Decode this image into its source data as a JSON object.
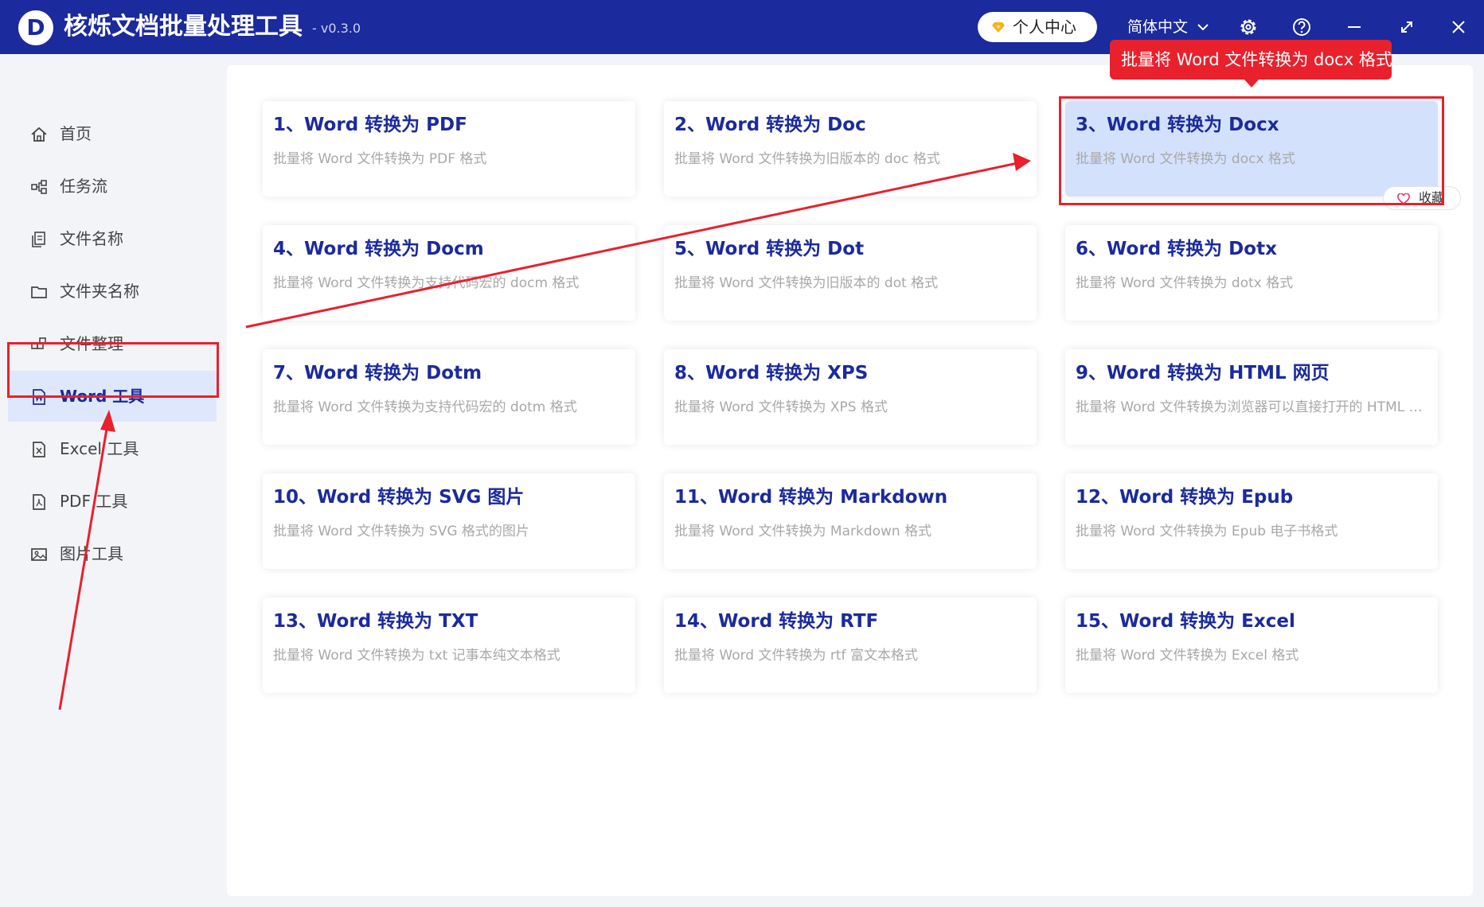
{
  "app": {
    "logo_letter": "D",
    "title": "核烁文档批量处理工具",
    "version": "- v0.3.0"
  },
  "header": {
    "profile_label": "个人中心",
    "language_label": "简体中文",
    "icons": [
      "diamond-icon",
      "chevron-down-icon",
      "gear-icon",
      "help-icon",
      "minimize-icon",
      "maximize-icon",
      "close-icon"
    ]
  },
  "sidebar": {
    "items": [
      {
        "label": "首页",
        "icon": "home-icon"
      },
      {
        "label": "任务流",
        "icon": "workflow-icon"
      },
      {
        "label": "文件名称",
        "icon": "file-name-icon"
      },
      {
        "label": "文件夹名称",
        "icon": "folder-icon"
      },
      {
        "label": "文件整理",
        "icon": "organize-icon"
      },
      {
        "label": "Word 工具",
        "icon": "word-file-icon",
        "active": true
      },
      {
        "label": "Excel 工具",
        "icon": "excel-file-icon"
      },
      {
        "label": "PDF 工具",
        "icon": "pdf-file-icon"
      },
      {
        "label": "图片工具",
        "icon": "image-icon"
      }
    ]
  },
  "tools": [
    {
      "title": "1、Word 转换为 PDF",
      "desc": "批量将 Word 文件转换为 PDF 格式"
    },
    {
      "title": "2、Word 转换为 Doc",
      "desc": "批量将 Word 文件转换为旧版本的 doc 格式"
    },
    {
      "title": "3、Word 转换为 Docx",
      "desc": "批量将 Word 文件转换为 docx 格式",
      "selected": true
    },
    {
      "title": "4、Word 转换为 Docm",
      "desc": "批量将 Word 文件转换为支持代码宏的 docm 格式"
    },
    {
      "title": "5、Word 转换为 Dot",
      "desc": "批量将 Word 文件转换为旧版本的 dot 格式"
    },
    {
      "title": "6、Word 转换为 Dotx",
      "desc": "批量将 Word 文件转换为 dotx 格式"
    },
    {
      "title": "7、Word 转换为 Dotm",
      "desc": "批量将 Word 文件转换为支持代码宏的 dotm 格式"
    },
    {
      "title": "8、Word 转换为 XPS",
      "desc": "批量将 Word 文件转换为 XPS 格式"
    },
    {
      "title": "9、Word 转换为 HTML 网页",
      "desc": "批量将 Word 文件转换为浏览器可以直接打开的 HTML 网页文件"
    },
    {
      "title": "10、Word 转换为 SVG 图片",
      "desc": "批量将 Word 文件转换为 SVG 格式的图片"
    },
    {
      "title": "11、Word 转换为 Markdown",
      "desc": "批量将 Word 文件转换为 Markdown 格式"
    },
    {
      "title": "12、Word 转换为 Epub",
      "desc": "批量将 Word 文件转换为 Epub 电子书格式"
    },
    {
      "title": "13、Word 转换为 TXT",
      "desc": "批量将 Word 文件转换为 txt 记事本纯文本格式"
    },
    {
      "title": "14、Word 转换为 RTF",
      "desc": "批量将 Word 文件转换为 rtf 富文本格式"
    },
    {
      "title": "15、Word 转换为 Excel",
      "desc": "批量将 Word 文件转换为 Excel 格式"
    }
  ],
  "favorite_label": "收藏",
  "tooltip": "批量将 Word 文件转换为 docx 格式",
  "colors": {
    "brand": "#1b2a9c",
    "annotation_red": "#e8212d",
    "selected_bg": "#d4e1fc",
    "active_nav_bg": "#dfe7fd"
  }
}
